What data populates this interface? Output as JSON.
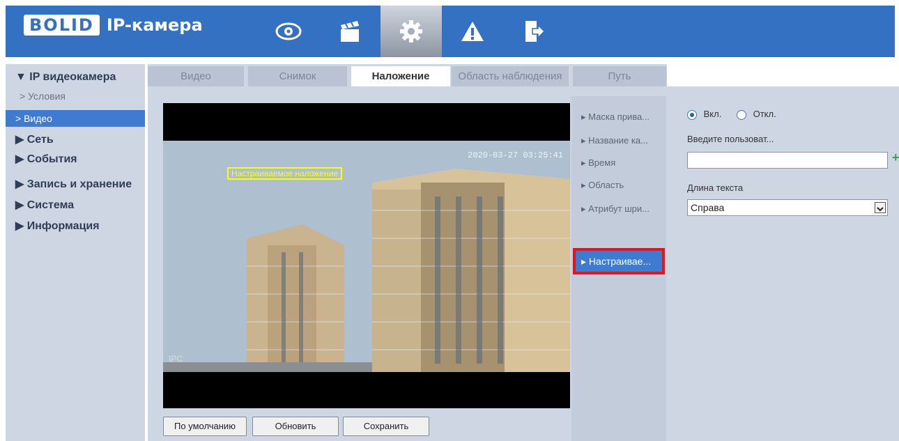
{
  "header": {
    "logo_brand": "BOLID",
    "logo_product": "IP-камера",
    "nav_icons": [
      "eye-icon",
      "clapperboard-icon",
      "gear-icon",
      "warning-icon",
      "logout-icon"
    ],
    "active_nav": "gear-icon"
  },
  "sidebar": {
    "root_label": "▼ IP видеокамера",
    "sub_items": [
      "> Условия",
      "> Видео"
    ],
    "active_sub": "> Видео",
    "sections": [
      "▶ Сеть",
      "▶ События",
      "▶ Запись и хранение",
      "▶ Система",
      "▶ Информация"
    ]
  },
  "tabs": [
    {
      "label": "Видео"
    },
    {
      "label": "Снимок"
    },
    {
      "label": "Наложение"
    },
    {
      "label": "Область наблюдения"
    },
    {
      "label": "Путь"
    }
  ],
  "active_tab": "Наложение",
  "video": {
    "timestamp": "2020-03-27 03:25:41",
    "overlay_text": "Настраиваемое наложение",
    "corner_label": "IPC"
  },
  "buttons": {
    "default": "По умолчанию",
    "refresh": "Обновить",
    "save": "Сохранить"
  },
  "submenu": {
    "items": [
      "▸ Маска прива...",
      "▸ Название ка...",
      "▸ Время",
      "▸ Область",
      "▸ Атрибут шри..."
    ],
    "active": "▸ Настраивае..."
  },
  "panel": {
    "on_label": "Вкл.",
    "off_label": "Откл.",
    "input_label": "Введите пользоват...",
    "input_value": "",
    "length_label": "Длина текста",
    "select_value": "Справа"
  },
  "colors": {
    "header_blue": "#3471c2",
    "active_blue": "#3f7bd0",
    "highlight_red": "#e8141b",
    "overlay_yellow": "#ffff00"
  }
}
